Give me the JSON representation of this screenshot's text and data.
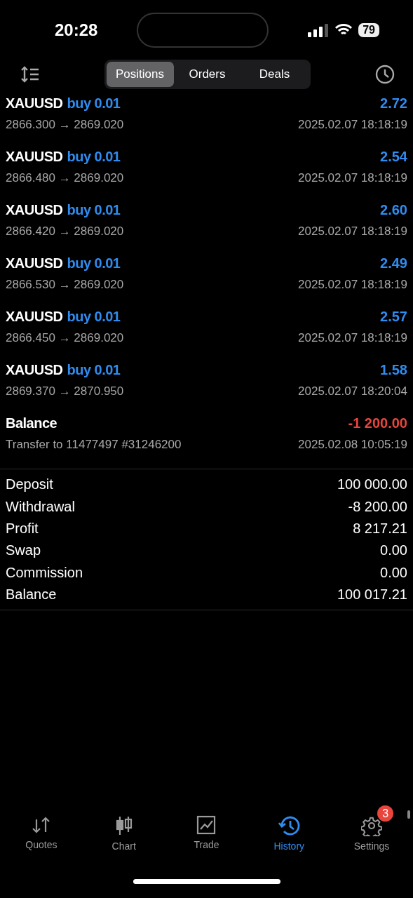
{
  "status_bar": {
    "time": "20:28",
    "battery": "79"
  },
  "segments": [
    {
      "label": "Positions",
      "selected": true
    },
    {
      "label": "Orders",
      "selected": false
    },
    {
      "label": "Deals",
      "selected": false
    }
  ],
  "deals": [
    {
      "kind": "trade",
      "symbol": "XAUUSD",
      "type": "buy 0.01",
      "prices": "2866.300 → 2869.020",
      "time": "2025.02.07 18:18:19",
      "profit": "2.72",
      "color": "#2f8cf0"
    },
    {
      "kind": "trade",
      "symbol": "XAUUSD",
      "type": "buy 0.01",
      "prices": "2866.480 → 2869.020",
      "time": "2025.02.07 18:18:19",
      "profit": "2.54",
      "color": "#2f8cf0"
    },
    {
      "kind": "trade",
      "symbol": "XAUUSD",
      "type": "buy 0.01",
      "prices": "2866.420 → 2869.020",
      "time": "2025.02.07 18:18:19",
      "profit": "2.60",
      "color": "#2f8cf0"
    },
    {
      "kind": "trade",
      "symbol": "XAUUSD",
      "type": "buy 0.01",
      "prices": "2866.530 → 2869.020",
      "time": "2025.02.07 18:18:19",
      "profit": "2.49",
      "color": "#2f8cf0"
    },
    {
      "kind": "trade",
      "symbol": "XAUUSD",
      "type": "buy 0.01",
      "prices": "2866.450 → 2869.020",
      "time": "2025.02.07 18:18:19",
      "profit": "2.57",
      "color": "#2f8cf0"
    },
    {
      "kind": "trade",
      "symbol": "XAUUSD",
      "type": "buy 0.01",
      "prices": "2869.370 → 2870.950",
      "time": "2025.02.07 18:20:04",
      "profit": "1.58",
      "color": "#2f8cf0"
    },
    {
      "kind": "balance",
      "symbol": "Balance",
      "prices": "Transfer to 11477497 #31246200",
      "time": "2025.02.08 10:05:19",
      "profit": "-1 200.00",
      "color": "#e8453c"
    }
  ],
  "summary": [
    {
      "label": "Deposit",
      "value": "100 000.00"
    },
    {
      "label": "Withdrawal",
      "value": "-8 200.00"
    },
    {
      "label": "Profit",
      "value": "8 217.21"
    },
    {
      "label": "Swap",
      "value": "0.00"
    },
    {
      "label": "Commission",
      "value": "0.00"
    },
    {
      "label": "Balance",
      "value": "100 017.21"
    }
  ],
  "tab_bar": [
    {
      "label": "Quotes",
      "kind": "quotes",
      "selected": false
    },
    {
      "label": "Chart",
      "kind": "chart",
      "selected": false
    },
    {
      "label": "Trade",
      "kind": "trade",
      "selected": false
    },
    {
      "label": "History",
      "kind": "history",
      "selected": true
    },
    {
      "label": "Settings",
      "kind": "settings",
      "selected": false,
      "badge": "3"
    }
  ]
}
